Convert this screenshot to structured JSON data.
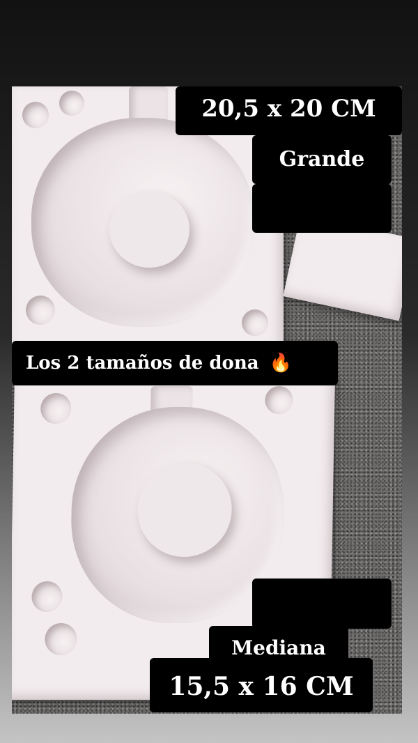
{
  "labels": {
    "size_large": "20,5 x 20 CM",
    "name_large": "Grande",
    "caption": "Los 2 tamaños de dona",
    "caption_icon": "🔥",
    "name_medium": "Mediana",
    "size_medium": "15,5 x 16 CM"
  },
  "icons": {
    "caption_icon": "fire-icon"
  },
  "colors": {
    "label_background": "#000000",
    "label_text": "#ffffff",
    "mold": "#f2ecee"
  }
}
